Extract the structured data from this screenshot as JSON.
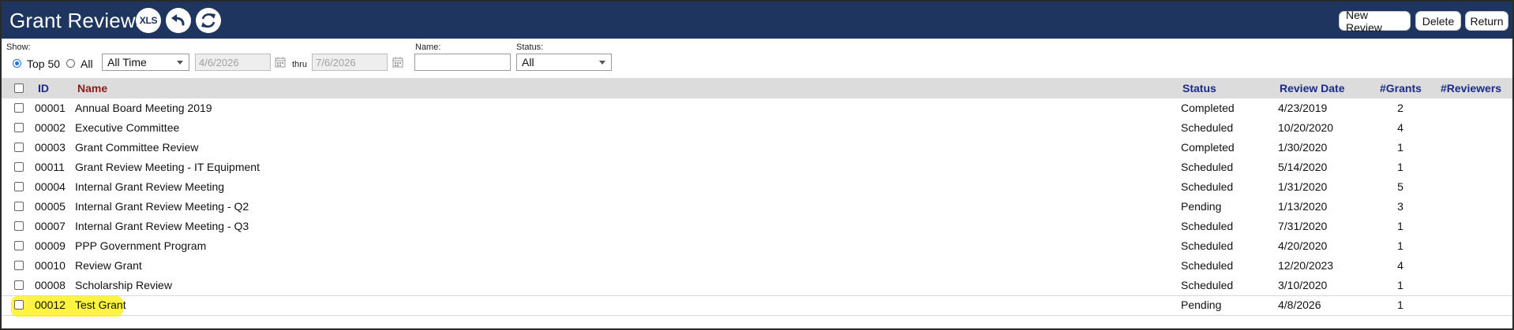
{
  "header": {
    "title": "Grant Reviews",
    "xls_label": "XLS",
    "buttons": {
      "new_review": "New Review",
      "delete": "Delete",
      "return": "Return"
    }
  },
  "filters": {
    "show_label": "Show:",
    "top50_label": "Top 50",
    "all_label": "All",
    "time_range": "All Time",
    "from_date": "4/6/2026",
    "thru_label": "thru",
    "to_date": "7/6/2026",
    "name_label": "Name:",
    "name_value": "",
    "status_label": "Status:",
    "status_value": "All"
  },
  "table": {
    "columns": {
      "id": "ID",
      "name": "Name",
      "status": "Status",
      "review_date": "Review Date",
      "grants": "#Grants",
      "reviewers": "#Reviewers"
    },
    "rows": [
      {
        "id": "00001",
        "name": "Annual Board Meeting 2019",
        "status": "Completed",
        "review_date": "4/23/2019",
        "grants": "2",
        "reviewers": ""
      },
      {
        "id": "00002",
        "name": "Executive Committee",
        "status": "Scheduled",
        "review_date": "10/20/2020",
        "grants": "4",
        "reviewers": ""
      },
      {
        "id": "00003",
        "name": "Grant Committee Review",
        "status": "Completed",
        "review_date": "1/30/2020",
        "grants": "1",
        "reviewers": ""
      },
      {
        "id": "00011",
        "name": "Grant Review Meeting - IT Equipment",
        "status": "Scheduled",
        "review_date": "5/14/2020",
        "grants": "1",
        "reviewers": ""
      },
      {
        "id": "00004",
        "name": "Internal Grant Review Meeting",
        "status": "Scheduled",
        "review_date": "1/31/2020",
        "grants": "5",
        "reviewers": ""
      },
      {
        "id": "00005",
        "name": "Internal Grant Review Meeting - Q2",
        "status": "Pending",
        "review_date": "1/13/2020",
        "grants": "3",
        "reviewers": ""
      },
      {
        "id": "00007",
        "name": "Internal Grant Review Meeting - Q3",
        "status": "Scheduled",
        "review_date": "7/31/2020",
        "grants": "1",
        "reviewers": ""
      },
      {
        "id": "00009",
        "name": "PPP Government Program",
        "status": "Scheduled",
        "review_date": "4/20/2020",
        "grants": "1",
        "reviewers": ""
      },
      {
        "id": "00010",
        "name": "Review Grant",
        "status": "Scheduled",
        "review_date": "12/20/2023",
        "grants": "4",
        "reviewers": ""
      },
      {
        "id": "00008",
        "name": "Scholarship Review",
        "status": "Scheduled",
        "review_date": "3/10/2020",
        "grants": "1",
        "reviewers": ""
      },
      {
        "id": "00012",
        "name": "Test Grant",
        "status": "Pending",
        "review_date": "4/8/2026",
        "grants": "1",
        "reviewers": ""
      }
    ]
  },
  "colors": {
    "header_bg": "#1e3560",
    "column_header_text": "#1a2a8a",
    "name_header_text": "#8b1a1a",
    "highlight": "#fff200"
  },
  "icons": [
    "xls-export-icon",
    "undo-icon",
    "refresh-icon",
    "calendar-icon",
    "chevron-down-icon"
  ]
}
